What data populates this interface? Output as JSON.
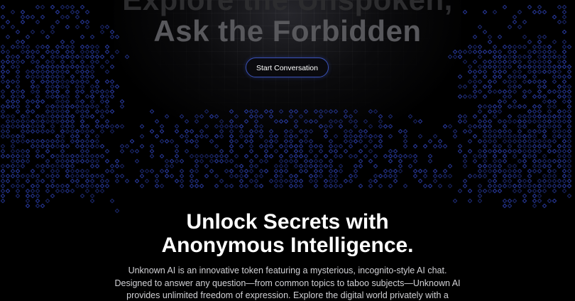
{
  "hero": {
    "title_line1": "Explore the Unspoken,",
    "title_line2": "Ask the Forbidden",
    "cta_label": "Start Conversation"
  },
  "about": {
    "title_line1": "Unlock Secrets with",
    "title_line2": "Anonymous Intelligence.",
    "description_lines": [
      "Unknown AI is an innovative token featuring a mysterious, incognito-style AI chat.",
      "Designed to answer any question—from common topics to taboo subjects—Unknown AI",
      "provides unlimited freedom of expression. Explore the digital world privately with a"
    ]
  },
  "colors": {
    "background": "#000000",
    "accent_blue": "#3a52b8",
    "pattern_blue": "#2b3ea8",
    "text_white": "#ffffff"
  }
}
